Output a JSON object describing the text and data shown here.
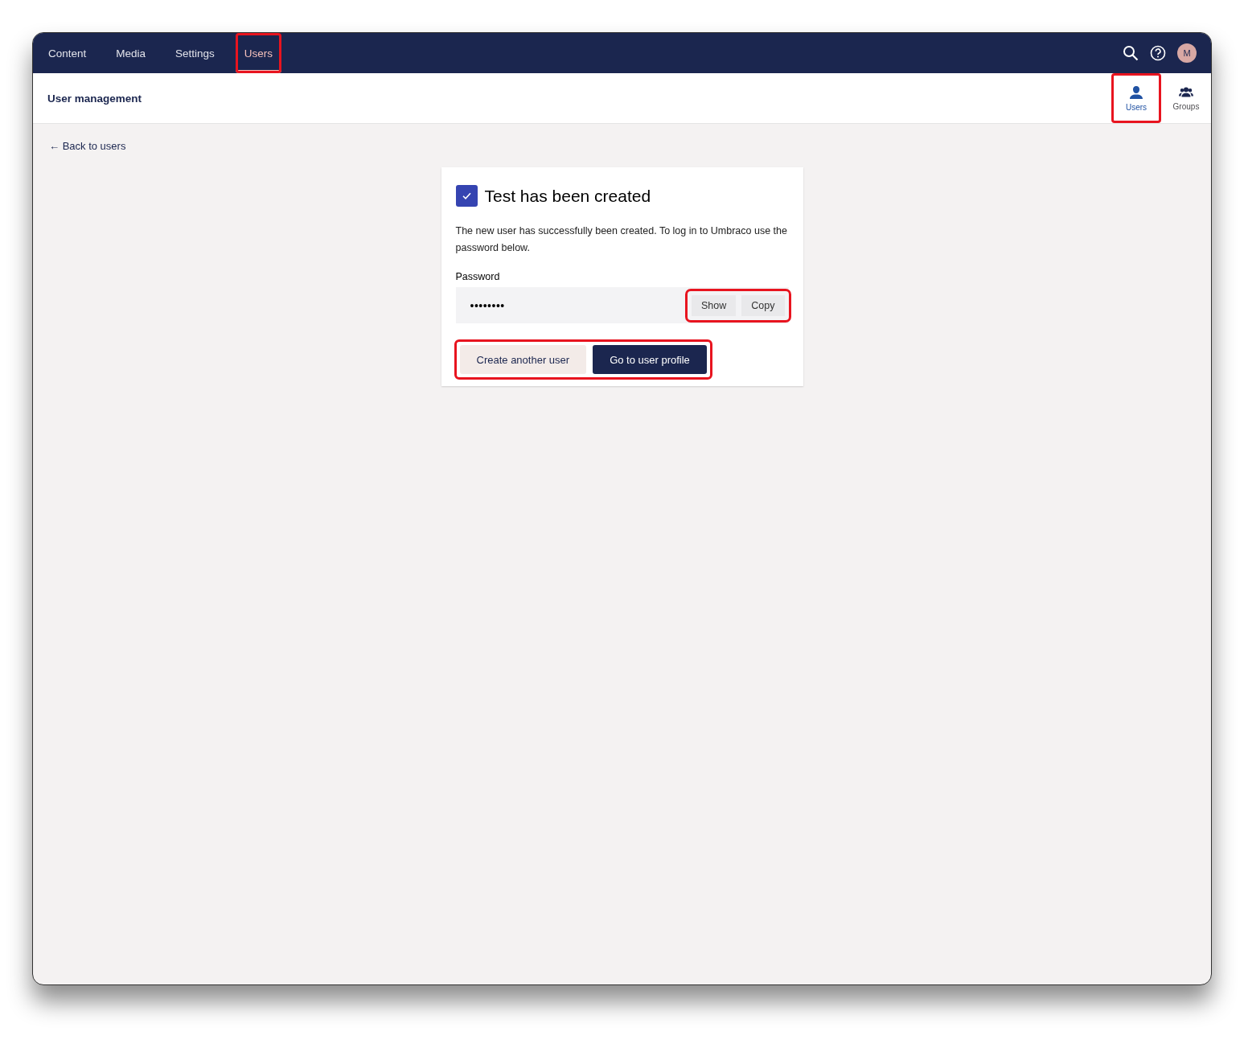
{
  "top_nav": {
    "tabs": [
      {
        "label": "Content",
        "selected": false,
        "highlighted": false
      },
      {
        "label": "Media",
        "selected": false,
        "highlighted": false
      },
      {
        "label": "Settings",
        "selected": false,
        "highlighted": false
      },
      {
        "label": "Users",
        "selected": true,
        "highlighted": true
      }
    ],
    "avatar": {
      "initial": "M"
    }
  },
  "header": {
    "title": "User management",
    "views": [
      {
        "label": "Users",
        "kind": "user",
        "selected": true,
        "highlighted": true
      },
      {
        "label": "Groups",
        "kind": "group",
        "selected": false,
        "highlighted": false
      }
    ]
  },
  "back_link": {
    "arrow": "←",
    "label": "Back to users"
  },
  "card": {
    "checked": true,
    "title": "Test has been created",
    "message": "The new user has successfully been created. To log in to Umbraco use the password below.",
    "password": {
      "label": "Password",
      "value": "••••••••",
      "actions": [
        "Show",
        "Copy"
      ],
      "highlighted": true
    },
    "buttons": {
      "highlighted": true,
      "items": [
        {
          "label": "Create another user",
          "kind": "secondary"
        },
        {
          "label": "Go to user profile",
          "kind": "primary"
        }
      ]
    }
  }
}
